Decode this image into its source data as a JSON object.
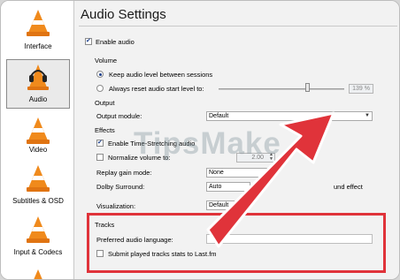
{
  "sidebar": {
    "items": [
      {
        "label": "Interface",
        "icon": "vlc-cone-icon"
      },
      {
        "label": "Audio",
        "icon": "headphones-cone-icon",
        "selected": true
      },
      {
        "label": "Video",
        "icon": "vlc-cone-icon"
      },
      {
        "label": "Subtitles & OSD",
        "icon": "vlc-cone-icon"
      },
      {
        "label": "Input & Codecs",
        "icon": "vlc-cone-icon"
      }
    ]
  },
  "header": {
    "title": "Audio Settings"
  },
  "audio": {
    "enable_label": "Enable audio",
    "enable_checked": true,
    "volume": {
      "section": "Volume",
      "keep_label": "Keep audio level between sessions",
      "reset_label": "Always reset audio start level to:",
      "level_pct": "139 %",
      "level_value": 139
    },
    "output": {
      "section": "Output",
      "module_label": "Output module:",
      "module_value": "Default"
    },
    "effects": {
      "section": "Effects",
      "time_stretch_label": "Enable Time-Stretching audio",
      "normalize_label": "Normalize volume to:",
      "normalize_value": "2.00",
      "replay_label": "Replay gain mode:",
      "replay_value": "None",
      "dolby_label": "Dolby Surround:",
      "dolby_value": "Auto",
      "headphone_effect": "und effect",
      "visual_label": "Visualization:",
      "visual_value": "Default"
    },
    "tracks": {
      "section": "Tracks",
      "pref_lang_label": "Preferred audio language:",
      "pref_lang_value": "",
      "submit_label": "Submit played tracks stats to Last.fm"
    }
  },
  "watermark": {
    "text": "TipsMake"
  },
  "colors": {
    "highlight": "#e0333a",
    "accent": "#1c3f8c",
    "cone": "#f08a1c"
  }
}
